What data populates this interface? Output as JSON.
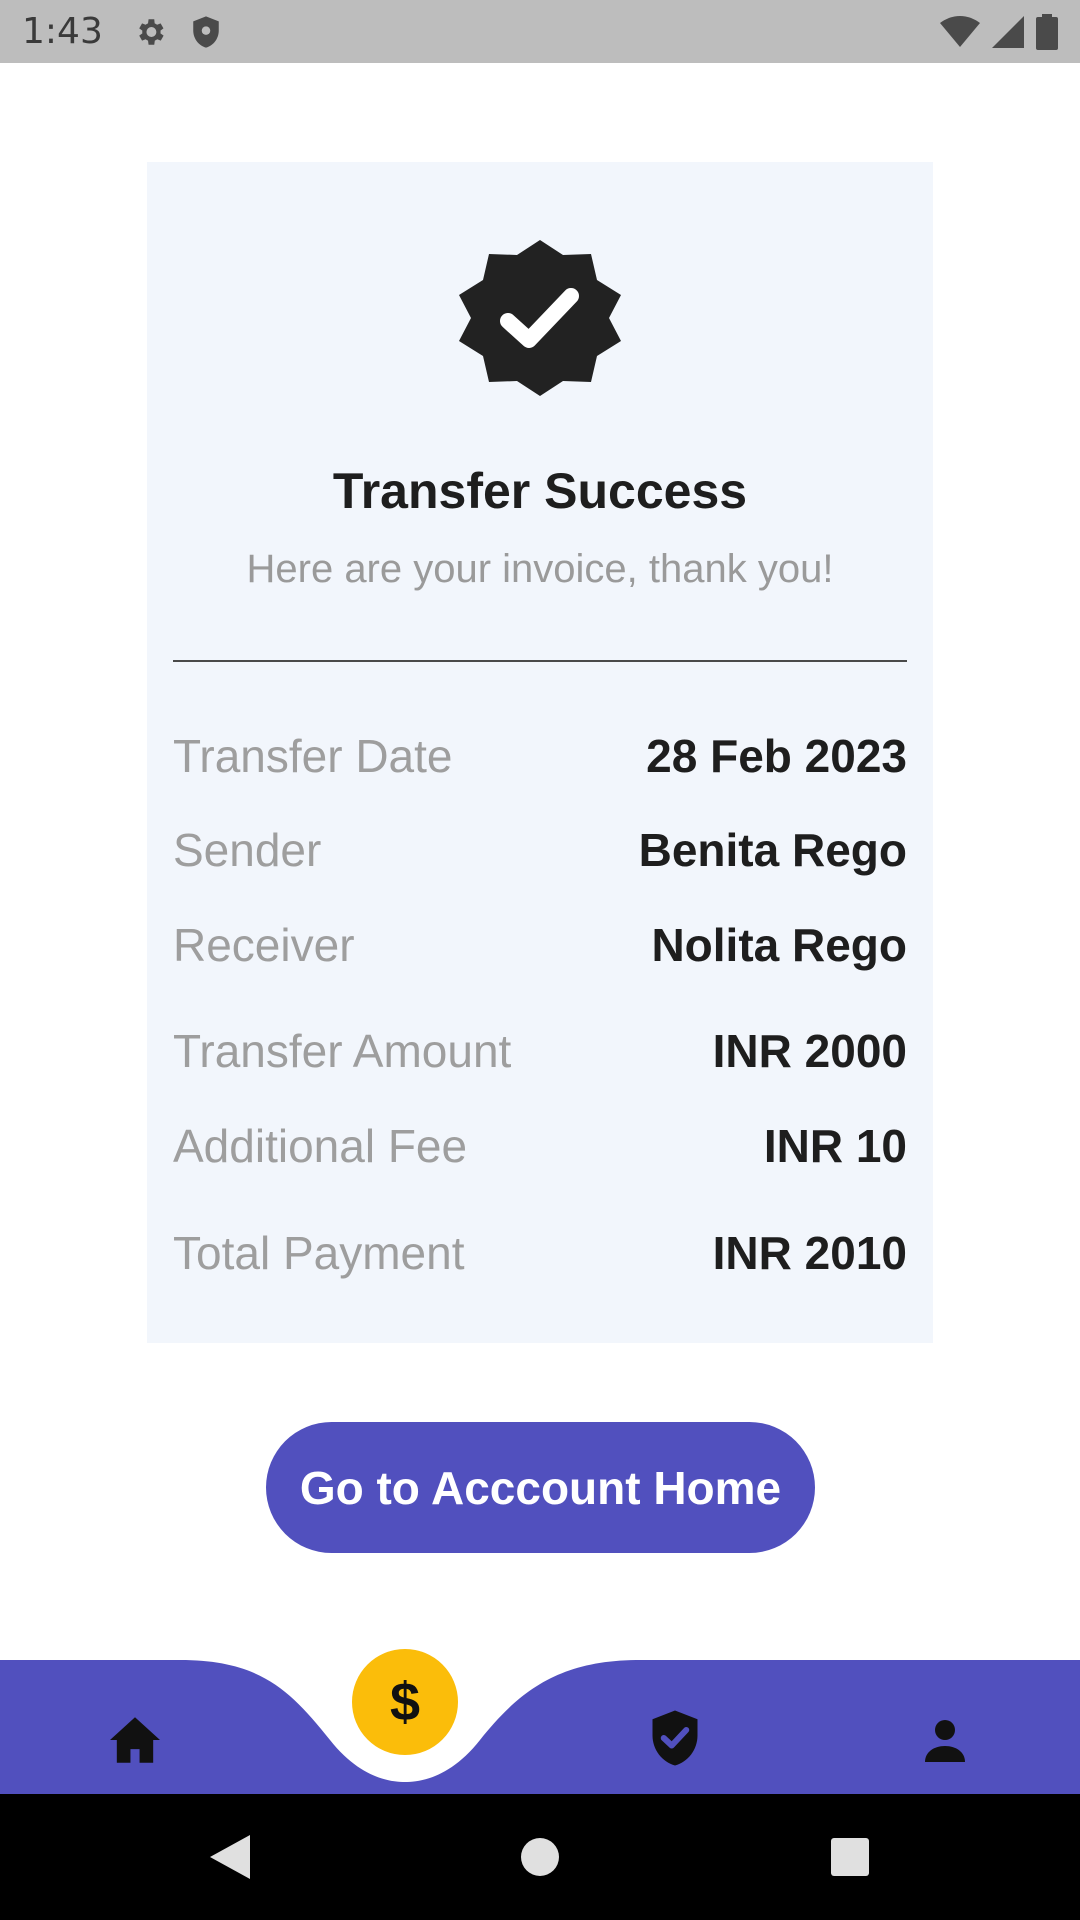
{
  "status_bar": {
    "time": "1:43",
    "icons_left": [
      "gear-icon",
      "shield-icon"
    ],
    "icons_right": [
      "wifi-icon",
      "signal-icon",
      "battery-icon"
    ]
  },
  "receipt": {
    "icon": "verified-badge-icon",
    "title": "Transfer Success",
    "subtitle": "Here are your invoice, thank you!",
    "rows": [
      {
        "label": "Transfer Date",
        "value": "28 Feb 2023"
      },
      {
        "label": "Sender",
        "value": "Benita Rego"
      },
      {
        "label": "Receiver",
        "value": "Nolita Rego"
      },
      {
        "label": "Transfer Amount",
        "value": "INR 2000"
      },
      {
        "label": "Additional Fee",
        "value": "INR 10"
      },
      {
        "label": "Total Payment",
        "value": "INR 2010"
      }
    ]
  },
  "actions": {
    "home_button_label": "Go to Acccount Home"
  },
  "bottom_nav": {
    "items": [
      "home-icon",
      "dollar-icon",
      "shield-check-icon",
      "person-icon"
    ],
    "fab_symbol": "$",
    "colors": {
      "bar": "#5150be",
      "fab": "#fbbd0a"
    }
  },
  "colors": {
    "accent": "#5150be",
    "card_bg": "#f2f6fc",
    "label": "#9e9e9e",
    "value": "#1e1e1e"
  }
}
